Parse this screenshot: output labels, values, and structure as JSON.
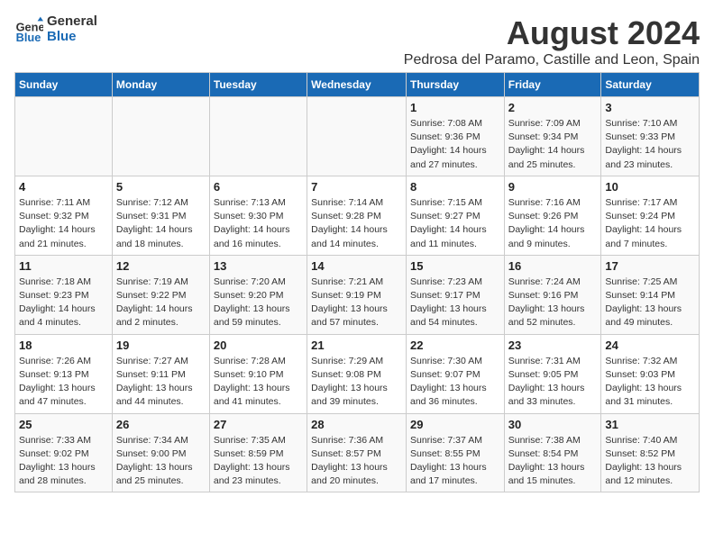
{
  "logo": {
    "line1": "General",
    "line2": "Blue"
  },
  "title": "August 2024",
  "subtitle": "Pedrosa del Paramo, Castille and Leon, Spain",
  "weekdays": [
    "Sunday",
    "Monday",
    "Tuesday",
    "Wednesday",
    "Thursday",
    "Friday",
    "Saturday"
  ],
  "weeks": [
    [
      {
        "day": "",
        "sunrise": "",
        "sunset": "",
        "daylight": ""
      },
      {
        "day": "",
        "sunrise": "",
        "sunset": "",
        "daylight": ""
      },
      {
        "day": "",
        "sunrise": "",
        "sunset": "",
        "daylight": ""
      },
      {
        "day": "",
        "sunrise": "",
        "sunset": "",
        "daylight": ""
      },
      {
        "day": "1",
        "sunrise": "Sunrise: 7:08 AM",
        "sunset": "Sunset: 9:36 PM",
        "daylight": "Daylight: 14 hours and 27 minutes."
      },
      {
        "day": "2",
        "sunrise": "Sunrise: 7:09 AM",
        "sunset": "Sunset: 9:34 PM",
        "daylight": "Daylight: 14 hours and 25 minutes."
      },
      {
        "day": "3",
        "sunrise": "Sunrise: 7:10 AM",
        "sunset": "Sunset: 9:33 PM",
        "daylight": "Daylight: 14 hours and 23 minutes."
      }
    ],
    [
      {
        "day": "4",
        "sunrise": "Sunrise: 7:11 AM",
        "sunset": "Sunset: 9:32 PM",
        "daylight": "Daylight: 14 hours and 21 minutes."
      },
      {
        "day": "5",
        "sunrise": "Sunrise: 7:12 AM",
        "sunset": "Sunset: 9:31 PM",
        "daylight": "Daylight: 14 hours and 18 minutes."
      },
      {
        "day": "6",
        "sunrise": "Sunrise: 7:13 AM",
        "sunset": "Sunset: 9:30 PM",
        "daylight": "Daylight: 14 hours and 16 minutes."
      },
      {
        "day": "7",
        "sunrise": "Sunrise: 7:14 AM",
        "sunset": "Sunset: 9:28 PM",
        "daylight": "Daylight: 14 hours and 14 minutes."
      },
      {
        "day": "8",
        "sunrise": "Sunrise: 7:15 AM",
        "sunset": "Sunset: 9:27 PM",
        "daylight": "Daylight: 14 hours and 11 minutes."
      },
      {
        "day": "9",
        "sunrise": "Sunrise: 7:16 AM",
        "sunset": "Sunset: 9:26 PM",
        "daylight": "Daylight: 14 hours and 9 minutes."
      },
      {
        "day": "10",
        "sunrise": "Sunrise: 7:17 AM",
        "sunset": "Sunset: 9:24 PM",
        "daylight": "Daylight: 14 hours and 7 minutes."
      }
    ],
    [
      {
        "day": "11",
        "sunrise": "Sunrise: 7:18 AM",
        "sunset": "Sunset: 9:23 PM",
        "daylight": "Daylight: 14 hours and 4 minutes."
      },
      {
        "day": "12",
        "sunrise": "Sunrise: 7:19 AM",
        "sunset": "Sunset: 9:22 PM",
        "daylight": "Daylight: 14 hours and 2 minutes."
      },
      {
        "day": "13",
        "sunrise": "Sunrise: 7:20 AM",
        "sunset": "Sunset: 9:20 PM",
        "daylight": "Daylight: 13 hours and 59 minutes."
      },
      {
        "day": "14",
        "sunrise": "Sunrise: 7:21 AM",
        "sunset": "Sunset: 9:19 PM",
        "daylight": "Daylight: 13 hours and 57 minutes."
      },
      {
        "day": "15",
        "sunrise": "Sunrise: 7:23 AM",
        "sunset": "Sunset: 9:17 PM",
        "daylight": "Daylight: 13 hours and 54 minutes."
      },
      {
        "day": "16",
        "sunrise": "Sunrise: 7:24 AM",
        "sunset": "Sunset: 9:16 PM",
        "daylight": "Daylight: 13 hours and 52 minutes."
      },
      {
        "day": "17",
        "sunrise": "Sunrise: 7:25 AM",
        "sunset": "Sunset: 9:14 PM",
        "daylight": "Daylight: 13 hours and 49 minutes."
      }
    ],
    [
      {
        "day": "18",
        "sunrise": "Sunrise: 7:26 AM",
        "sunset": "Sunset: 9:13 PM",
        "daylight": "Daylight: 13 hours and 47 minutes."
      },
      {
        "day": "19",
        "sunrise": "Sunrise: 7:27 AM",
        "sunset": "Sunset: 9:11 PM",
        "daylight": "Daylight: 13 hours and 44 minutes."
      },
      {
        "day": "20",
        "sunrise": "Sunrise: 7:28 AM",
        "sunset": "Sunset: 9:10 PM",
        "daylight": "Daylight: 13 hours and 41 minutes."
      },
      {
        "day": "21",
        "sunrise": "Sunrise: 7:29 AM",
        "sunset": "Sunset: 9:08 PM",
        "daylight": "Daylight: 13 hours and 39 minutes."
      },
      {
        "day": "22",
        "sunrise": "Sunrise: 7:30 AM",
        "sunset": "Sunset: 9:07 PM",
        "daylight": "Daylight: 13 hours and 36 minutes."
      },
      {
        "day": "23",
        "sunrise": "Sunrise: 7:31 AM",
        "sunset": "Sunset: 9:05 PM",
        "daylight": "Daylight: 13 hours and 33 minutes."
      },
      {
        "day": "24",
        "sunrise": "Sunrise: 7:32 AM",
        "sunset": "Sunset: 9:03 PM",
        "daylight": "Daylight: 13 hours and 31 minutes."
      }
    ],
    [
      {
        "day": "25",
        "sunrise": "Sunrise: 7:33 AM",
        "sunset": "Sunset: 9:02 PM",
        "daylight": "Daylight: 13 hours and 28 minutes."
      },
      {
        "day": "26",
        "sunrise": "Sunrise: 7:34 AM",
        "sunset": "Sunset: 9:00 PM",
        "daylight": "Daylight: 13 hours and 25 minutes."
      },
      {
        "day": "27",
        "sunrise": "Sunrise: 7:35 AM",
        "sunset": "Sunset: 8:59 PM",
        "daylight": "Daylight: 13 hours and 23 minutes."
      },
      {
        "day": "28",
        "sunrise": "Sunrise: 7:36 AM",
        "sunset": "Sunset: 8:57 PM",
        "daylight": "Daylight: 13 hours and 20 minutes."
      },
      {
        "day": "29",
        "sunrise": "Sunrise: 7:37 AM",
        "sunset": "Sunset: 8:55 PM",
        "daylight": "Daylight: 13 hours and 17 minutes."
      },
      {
        "day": "30",
        "sunrise": "Sunrise: 7:38 AM",
        "sunset": "Sunset: 8:54 PM",
        "daylight": "Daylight: 13 hours and 15 minutes."
      },
      {
        "day": "31",
        "sunrise": "Sunrise: 7:40 AM",
        "sunset": "Sunset: 8:52 PM",
        "daylight": "Daylight: 13 hours and 12 minutes."
      }
    ]
  ]
}
